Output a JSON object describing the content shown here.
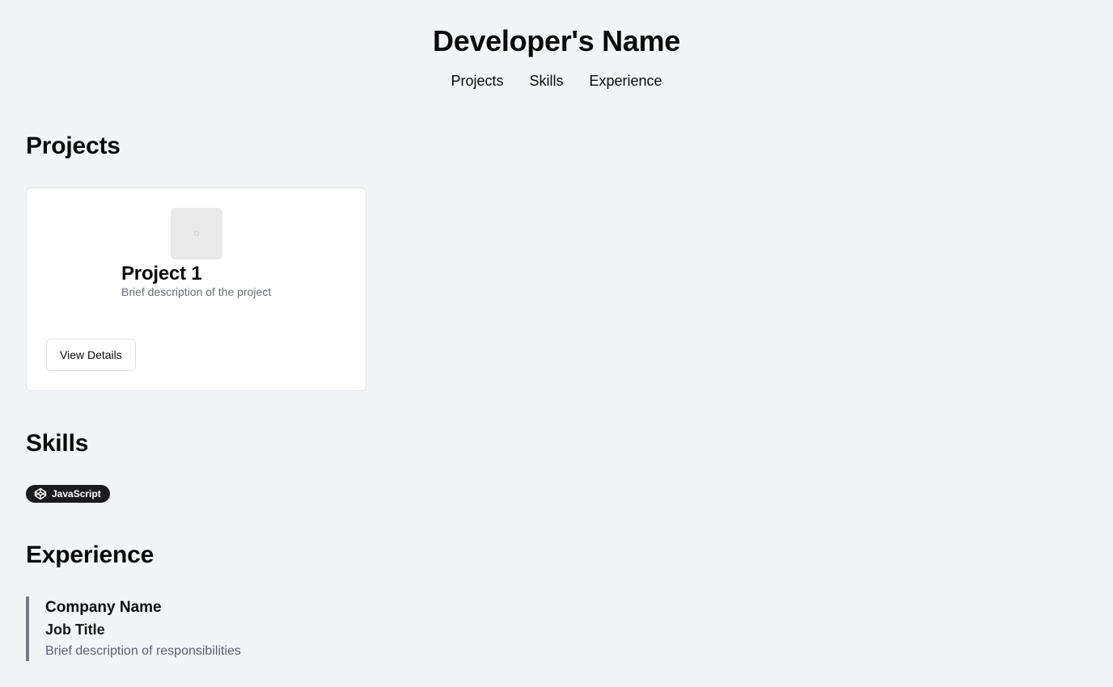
{
  "header": {
    "title": "Developer's Name",
    "nav": [
      "Projects",
      "Skills",
      "Experience"
    ]
  },
  "sections": {
    "projects": "Projects",
    "skills": "Skills",
    "experience": "Experience"
  },
  "projects": [
    {
      "title": "Project 1",
      "description": "Brief description of the project",
      "button_label": "View Details",
      "thumbnail_icon": "image-placeholder-icon"
    }
  ],
  "skills": [
    {
      "label": "JavaScript",
      "icon": "codepen-icon"
    }
  ],
  "experience": [
    {
      "company": "Company Name",
      "title": "Job Title",
      "description": "Brief description of responsibilities"
    }
  ],
  "colors": {
    "background": "#f2f4f6",
    "card": "#ffffff",
    "badge": "#1b1b1d",
    "experience_border": "#777b83",
    "muted_text": "#6b6f76"
  }
}
